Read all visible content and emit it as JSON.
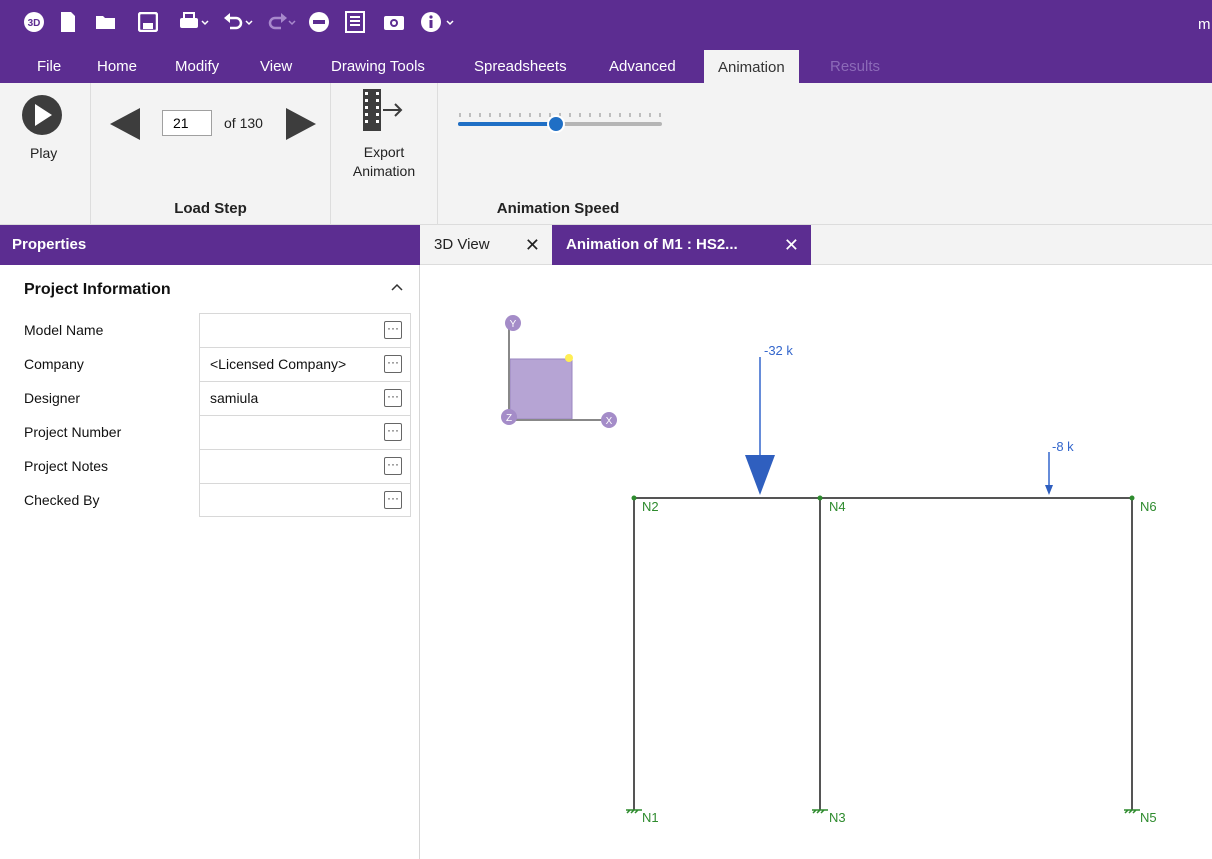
{
  "title_bar_partial_text": "m",
  "menu": [
    {
      "label": "File",
      "state": "normal"
    },
    {
      "label": "Home",
      "state": "normal"
    },
    {
      "label": "Modify",
      "state": "normal"
    },
    {
      "label": "View",
      "state": "normal"
    },
    {
      "label": "Drawing Tools",
      "state": "normal"
    },
    {
      "label": "Spreadsheets",
      "state": "normal"
    },
    {
      "label": "Advanced",
      "state": "normal"
    },
    {
      "label": "Animation",
      "state": "active"
    },
    {
      "label": "Results",
      "state": "disabled"
    }
  ],
  "quick_access_icons": [
    "3d-logo-icon",
    "new-file-icon",
    "open-folder-icon",
    "save-icon",
    "print-icon",
    "undo-icon",
    "redo-icon",
    "minus-circle-icon",
    "report-icon",
    "camera-icon",
    "info-icon"
  ],
  "ribbon": {
    "play_label": "Play",
    "load_step": {
      "current": "21",
      "of_label": "of 130",
      "group_label": "Load Step"
    },
    "export_label_line1": "Export",
    "export_label_line2": "Animation",
    "speed_group_label": "Animation Speed",
    "speed_fraction": 0.48
  },
  "properties": {
    "header": "Properties",
    "section_title": "Project Information",
    "rows": [
      {
        "label": "Model Name",
        "value": ""
      },
      {
        "label": "Company",
        "value": "<Licensed Company>"
      },
      {
        "label": "Designer",
        "value": "samiula"
      },
      {
        "label": "Project Number",
        "value": ""
      },
      {
        "label": "Project Notes",
        "value": ""
      },
      {
        "label": "Checked By",
        "value": ""
      }
    ]
  },
  "tabs": [
    {
      "label": "3D View",
      "active": false
    },
    {
      "label": "Animation of M1 : HS2...",
      "active": true
    }
  ],
  "model": {
    "axes": [
      "Y",
      "Z",
      "X"
    ],
    "nodes": [
      "N1",
      "N2",
      "N3",
      "N4",
      "N5",
      "N6"
    ],
    "loads": [
      "-32 k",
      "-8 k"
    ]
  },
  "colors": {
    "accent": "#5c2d91",
    "node": "#2e8b2e",
    "load": "#3366cc",
    "slider": "#1f6fc5"
  }
}
